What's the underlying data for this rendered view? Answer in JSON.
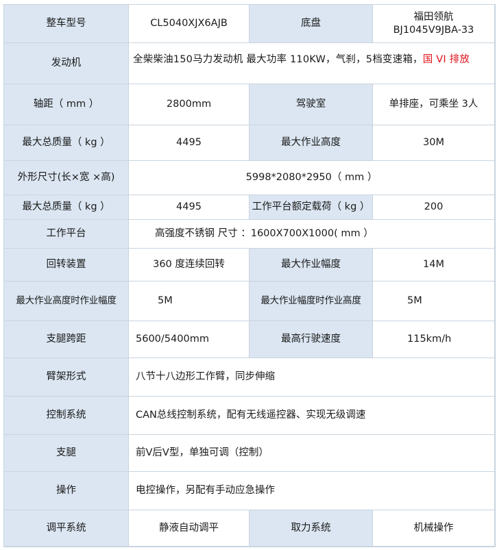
{
  "rows": [
    {
      "label": "整车型号",
      "value": "CL5040XJX6AJB",
      "label2": "底盘",
      "value2": [
        "福田领航",
        "BJ1045V9JBA-33"
      ]
    },
    {
      "label": "发动机",
      "value": "全柴柴油150马力发动机 最大功率 110KW，气刹，5档变速箱，",
      "value_red": "国 VI 排放"
    },
    {
      "label": "轴距（ mm ）",
      "value": "2800mm",
      "label2": "驾驶室",
      "value2": "单排座，可乘坐 3人"
    },
    {
      "label": "最大总质量（ kg ）",
      "value": "4495",
      "label2": "最大作业高度",
      "value2": "30M"
    },
    {
      "label": "外形尺寸(长×宽 ×高)",
      "value": "5998*2080*2950（ mm ）"
    },
    {
      "label": "最大总质量（ kg ）",
      "value": "4495",
      "label2": "工作平台额定载荷（ kg ）",
      "value2": "200"
    },
    {
      "label": "工作平台",
      "value": "高强度不锈钢 尺寸 ：1600X700X1000( mm ）"
    },
    {
      "label": "回转装置",
      "value": "360 度连续回转",
      "label2": "最大作业幅度",
      "value2": "14M"
    },
    {
      "label": "最大作业高度时作业幅度",
      "value": "5M",
      "label2": "最大作业幅度时作业高度",
      "value2": "5M"
    },
    {
      "label": "支腿跨距",
      "value": "5600/5400mm",
      "label2": "最高行驶速度",
      "value2": "115km/h"
    },
    {
      "label": "臂架形式",
      "value": "八节十八边形工作臂，同步伸缩"
    },
    {
      "label": "控制系统",
      "value": "CAN总线控制系统，配有无线遥控器、实现无级调速"
    },
    {
      "label": "支腿",
      "value": "前V后V型，单独可调（控制）"
    },
    {
      "label": "操作",
      "value": "电控操作，另配有手动应急操作"
    },
    {
      "label": "调平系统",
      "value": "静液自动调平",
      "label2": "取力系统",
      "value2": "机械操作"
    }
  ]
}
